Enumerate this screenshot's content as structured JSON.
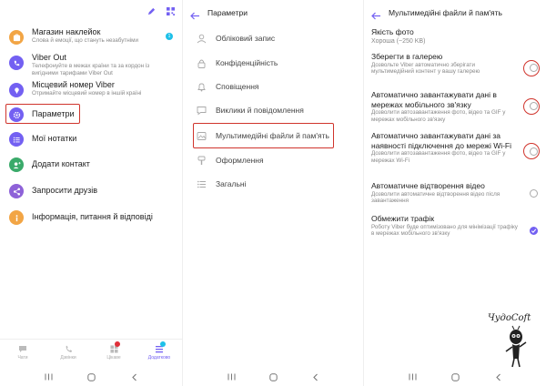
{
  "more_panel": {
    "items": [
      {
        "title": "Магазин наклейок",
        "subtitle": "Слова й емоції, що стануть незабутніми",
        "badge": "1",
        "color": "#f2a545",
        "icon": "sticker-icon"
      },
      {
        "title": "Viber Out",
        "subtitle": "Телефонуйте в межах країни та за кордон із вигідними тарифами Viber Out",
        "color": "#7360f2",
        "icon": "viber-out-icon"
      },
      {
        "title": "Місцевий номер Viber",
        "subtitle": "Отримайте місцевий номер в іншій країні",
        "color": "#7360f2",
        "icon": "local-number-icon"
      },
      {
        "title": "Параметри",
        "subtitle": "",
        "color": "#7360f2",
        "icon": "gear-icon"
      },
      {
        "title": "Мої нотатки",
        "subtitle": "",
        "color": "#7360f2",
        "icon": "notes-icon"
      },
      {
        "title": "Додати контакт",
        "subtitle": "",
        "color": "#3aaa6a",
        "icon": "add-contact-icon"
      },
      {
        "title": "Запросити друзів",
        "subtitle": "",
        "color": "#8e62d8",
        "icon": "share-icon"
      },
      {
        "title": "Інформація, питання й відповіді",
        "subtitle": "",
        "color": "#f2a545",
        "icon": "info-icon"
      }
    ],
    "bottom_nav": [
      {
        "label": "Чати",
        "icon": "chat-icon"
      },
      {
        "label": "Дзвінки",
        "icon": "phone-icon"
      },
      {
        "label": "Цікаве",
        "icon": "explore-icon"
      },
      {
        "label": "Додатково",
        "icon": "more-icon"
      }
    ]
  },
  "settings_panel": {
    "title": "Параметри",
    "items": [
      {
        "label": "Обліковий запис",
        "icon": "account-icon"
      },
      {
        "label": "Конфіденційність",
        "icon": "lock-icon"
      },
      {
        "label": "Сповіщення",
        "icon": "bell-icon"
      },
      {
        "label": "Виклики й повідомлення",
        "icon": "message-icon"
      },
      {
        "label": "Мультимедійні файли й пам'ять",
        "icon": "media-icon"
      },
      {
        "label": "Оформлення",
        "icon": "brush-icon"
      },
      {
        "label": "Загальні",
        "icon": "list-icon"
      }
    ]
  },
  "media_panel": {
    "title": "Мультимедійні файли й пам'ять",
    "photo_quality": {
      "title": "Якість фото",
      "value": "Хороша (~250 KB)"
    },
    "options": [
      {
        "title": "Зберегти в галерею",
        "subtitle": "Дозвольте Viber автоматично зберігати мультимедійний контент у вашу галерею",
        "checked": false
      },
      {
        "title": "Автоматично завантажувати дані в мережах мобільного зв'язку",
        "subtitle": "Дозволити автозавантаження фото, відео та GIF у мережах мобільного зв'язку",
        "checked": false
      },
      {
        "title": "Автоматично завантажувати дані за наявності підключення до мережі Wi-Fi",
        "subtitle": "Дозволити автозавантаження фото, відео та GIF у мережах Wi-Fi",
        "checked": false
      },
      {
        "title": "Автоматичне відтворення відео",
        "subtitle": "Дозволити автоматичне відтворення відео після завантаження",
        "checked": false
      },
      {
        "title": "Обмежити трафік",
        "subtitle": "Роботу Viber буде оптимізовано для мінімізації трафіку в мережах мобільного зв'язку",
        "checked": true
      }
    ]
  },
  "watermark": {
    "text": "ЧудоСоft"
  },
  "colors": {
    "accent": "#7360f2",
    "highlight": "#d0342c"
  }
}
